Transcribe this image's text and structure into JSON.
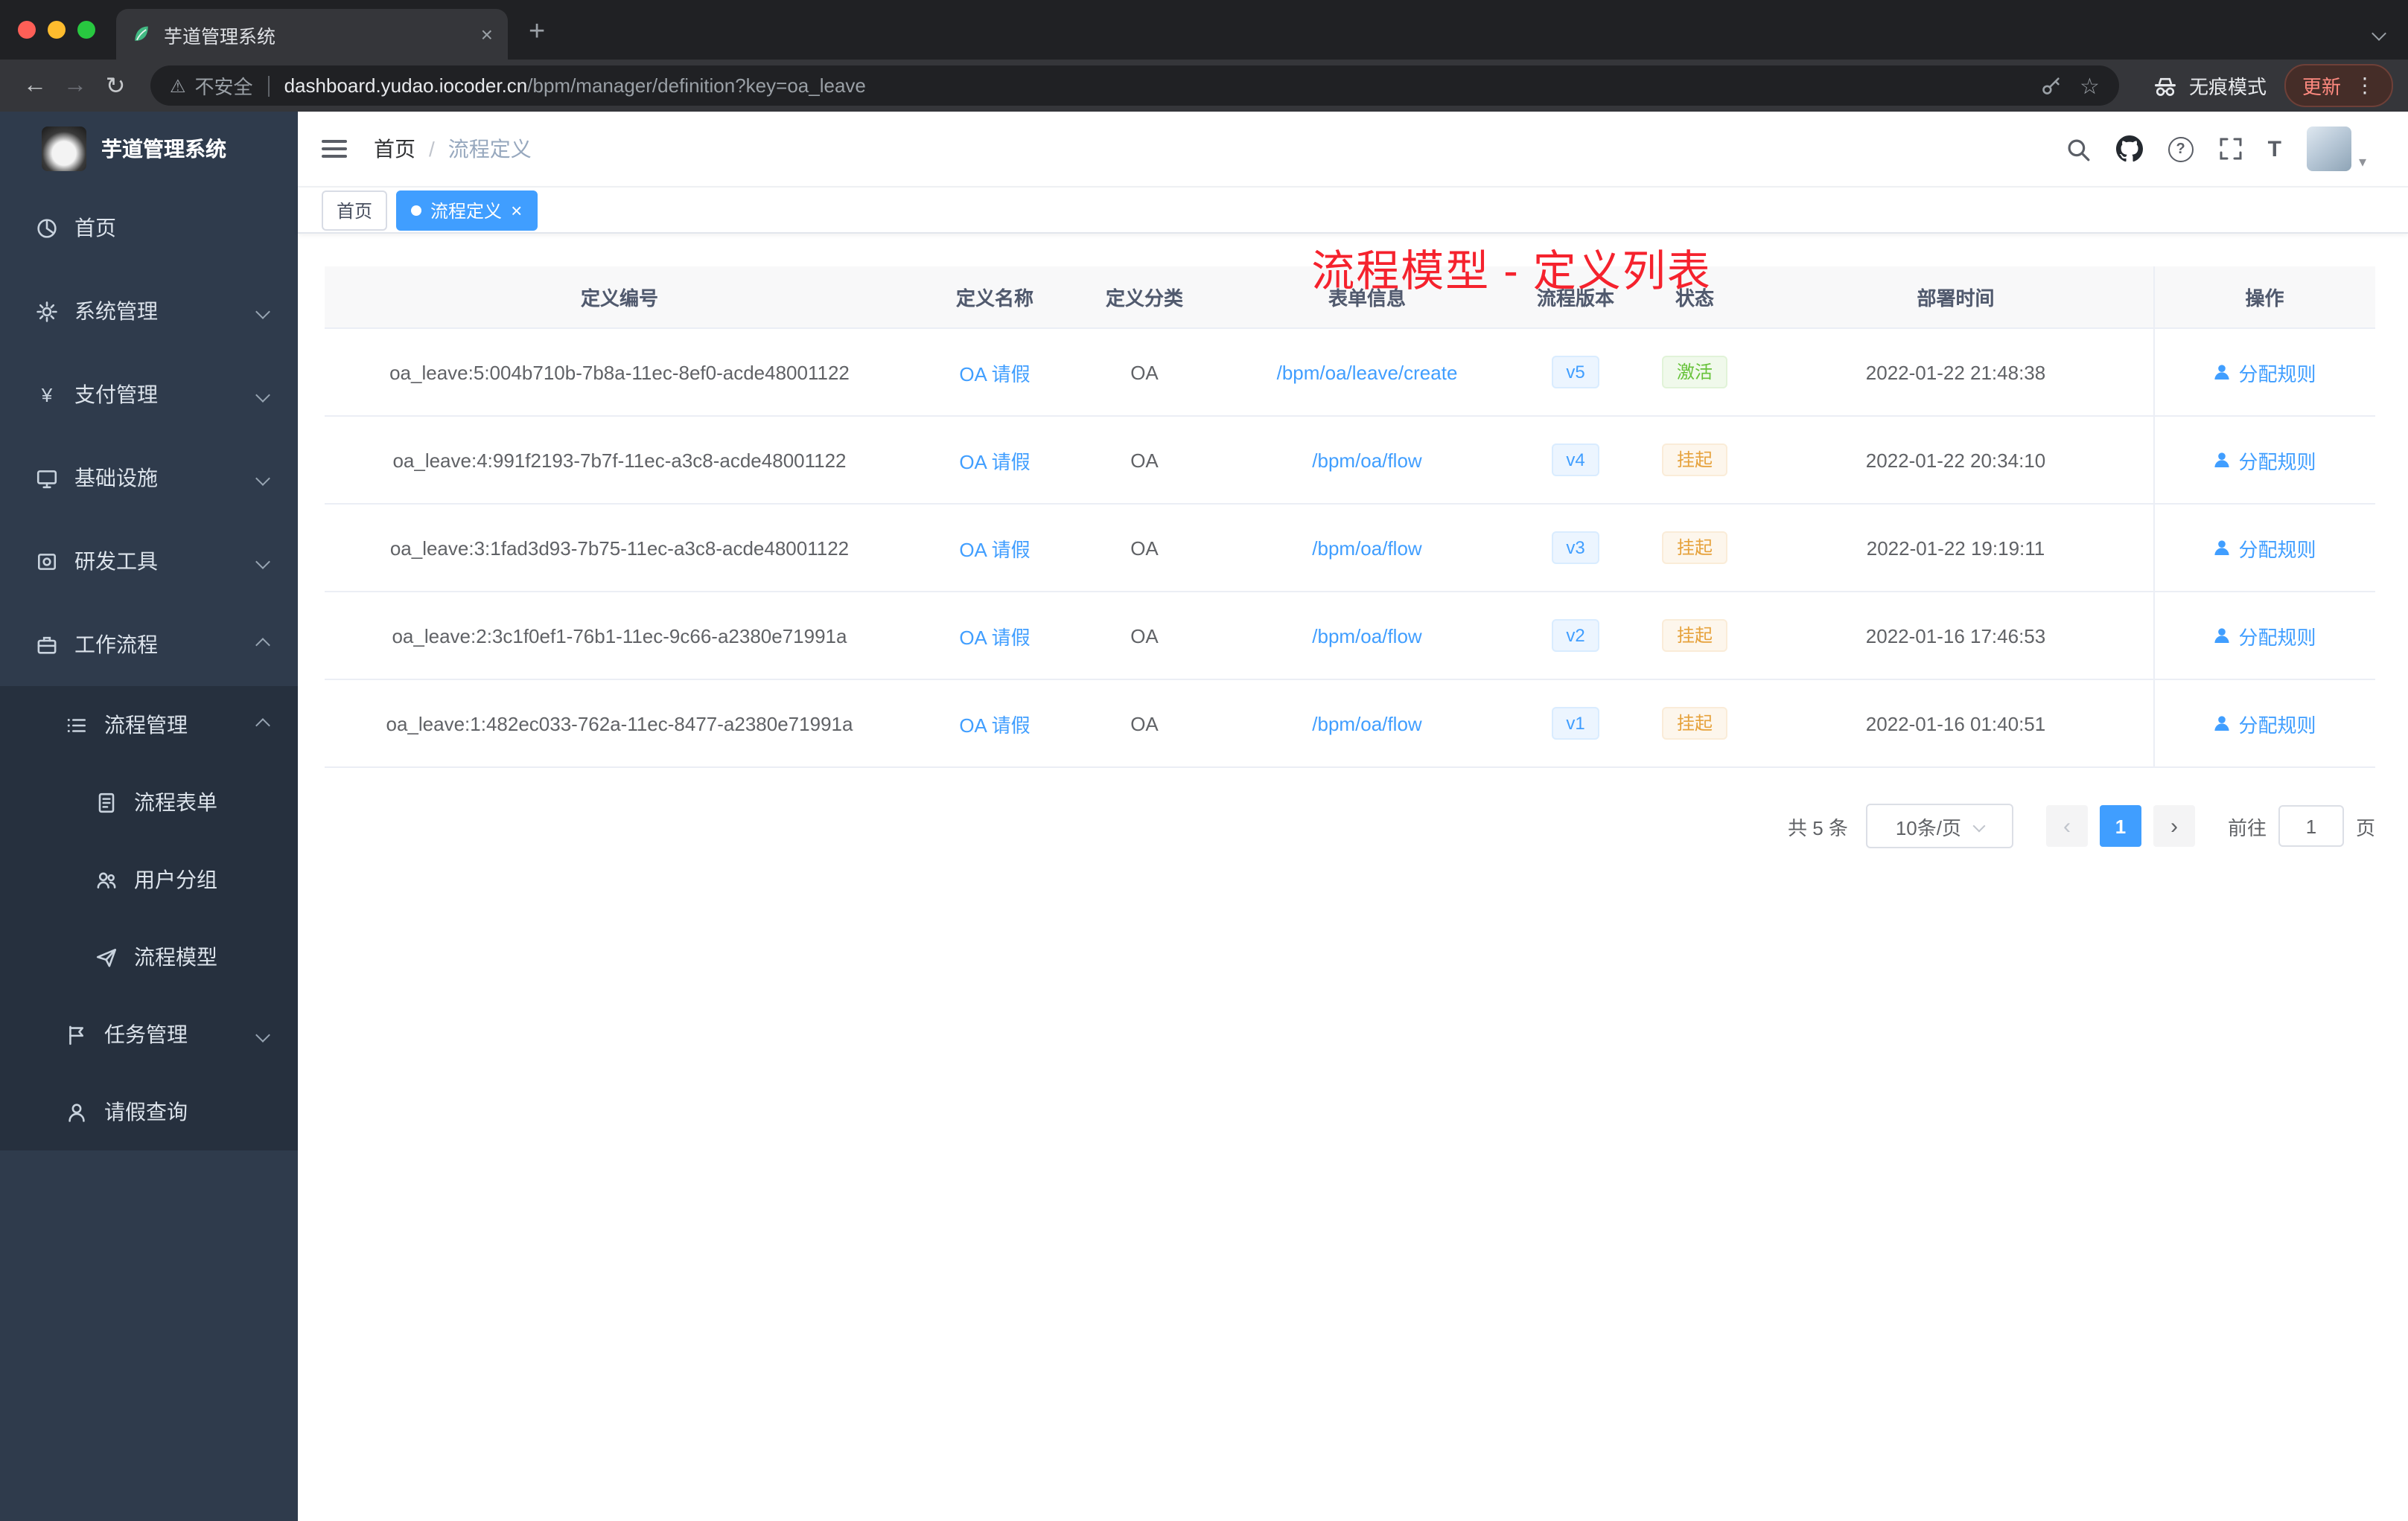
{
  "colors": {
    "accent": "#409eff",
    "success": "#67c23a",
    "success-bg": "#f0f9eb",
    "success-border": "#e1f3d8",
    "warning": "#e6a23c",
    "warning-bg": "#fdf6ec",
    "warning-border": "#faecd8",
    "version-bg": "#ecf5ff",
    "version-border": "#d9ecff",
    "annotation": "#f5222d",
    "sidebar-bg": "#2f3b4c",
    "submenu-bg": "#26303e",
    "chrome-dark": "#202124",
    "chrome-toolbar": "#35363a",
    "mac-red": "#ff5f57",
    "mac-yellow": "#febc2e",
    "mac-green": "#28c840"
  },
  "icons": {
    "close": "×",
    "plus": "+",
    "back": "←",
    "forward": "→",
    "reload": "↻",
    "warning": "⚠",
    "star": "☆",
    "more": "⋮",
    "yen": "¥",
    "caret": "▾",
    "question": "?",
    "font_size": "T",
    "prev": "‹",
    "next": "›"
  },
  "browser": {
    "tab_title": "芋道管理系统",
    "address": {
      "security_label": "不安全",
      "host": "dashboard.yudao.iocoder.cn",
      "path": "/bpm/manager/definition?key=oa_leave"
    },
    "incognito_label": "无痕模式",
    "update_label": "更新"
  },
  "sidebar": {
    "brand": "芋道管理系统",
    "items": [
      {
        "label": "首页"
      },
      {
        "label": "系统管理"
      },
      {
        "label": "支付管理"
      },
      {
        "label": "基础设施"
      },
      {
        "label": "研发工具"
      },
      {
        "label": "工作流程"
      },
      {
        "label": "流程管理"
      },
      {
        "label": "流程表单"
      },
      {
        "label": "用户分组"
      },
      {
        "label": "流程模型"
      },
      {
        "label": "任务管理"
      },
      {
        "label": "请假查询"
      }
    ]
  },
  "navbar": {
    "breadcrumb": {
      "home": "首页",
      "separator": "/",
      "current": "流程定义"
    }
  },
  "annotation": {
    "title": "流程模型 - 定义列表"
  },
  "tags": {
    "home": "首页",
    "active": "流程定义"
  },
  "table": {
    "columns": {
      "id": "定义编号",
      "name": "定义名称",
      "category": "定义分类",
      "form": "表单信息",
      "version": "流程版本",
      "status": "状态",
      "deploy_time": "部署时间",
      "action": "操作"
    },
    "action_label": "分配规则",
    "rows": [
      {
        "id": "oa_leave:5:004b710b-7b8a-11ec-8ef0-acde48001122",
        "name": "OA 请假",
        "category": "OA",
        "form": "/bpm/oa/leave/create",
        "version": "v5",
        "status": "激活",
        "time": "2022-01-22 21:48:38"
      },
      {
        "id": "oa_leave:4:991f2193-7b7f-11ec-a3c8-acde48001122",
        "name": "OA 请假",
        "category": "OA",
        "form": "/bpm/oa/flow",
        "version": "v4",
        "status": "挂起",
        "time": "2022-01-22 20:34:10"
      },
      {
        "id": "oa_leave:3:1fad3d93-7b75-11ec-a3c8-acde48001122",
        "name": "OA 请假",
        "category": "OA",
        "form": "/bpm/oa/flow",
        "version": "v3",
        "status": "挂起",
        "time": "2022-01-22 19:19:11"
      },
      {
        "id": "oa_leave:2:3c1f0ef1-76b1-11ec-9c66-a2380e71991a",
        "name": "OA 请假",
        "category": "OA",
        "form": "/bpm/oa/flow",
        "version": "v2",
        "status": "挂起",
        "time": "2022-01-16 17:46:53"
      },
      {
        "id": "oa_leave:1:482ec033-762a-11ec-8477-a2380e71991a",
        "name": "OA 请假",
        "category": "OA",
        "form": "/bpm/oa/flow",
        "version": "v1",
        "status": "挂起",
        "time": "2022-01-16 01:40:51"
      }
    ]
  },
  "pagination": {
    "total": "共 5 条",
    "page_size": "10条/页",
    "page": "1",
    "goto_label": "前往",
    "goto_value": "1",
    "goto_unit": "页"
  }
}
